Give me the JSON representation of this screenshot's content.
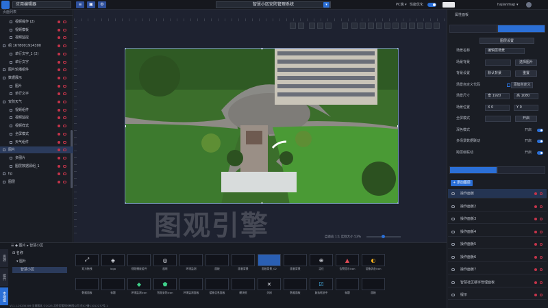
{
  "topbar": {
    "app_name": "应用编辑器",
    "title": "智慧小区安防管理系统",
    "device": "PC端 ▾",
    "preview_label": "性能优化",
    "user": "hajianmap ▾"
  },
  "left_panel": {
    "header": "页面列表",
    "items": [
      {
        "label": "视频操作 (2)",
        "indent": 14,
        "icon": "folder-icon"
      },
      {
        "label": "视频模板",
        "indent": 14,
        "icon": "video-icon"
      },
      {
        "label": "视频监控",
        "indent": 14,
        "icon": "video-icon"
      },
      {
        "label": "组 1678001914300",
        "indent": 4,
        "icon": "folder-icon"
      },
      {
        "label": "单行文字_1 (2)",
        "indent": 14,
        "icon": "text-icon"
      },
      {
        "label": "单行文字",
        "indent": 14,
        "icon": "text-icon"
      },
      {
        "label": "图片轮播组件",
        "indent": 4,
        "icon": "image-icon"
      },
      {
        "label": "数据展示",
        "indent": 4,
        "icon": "folder-icon"
      },
      {
        "label": "图片",
        "indent": 14,
        "icon": "image-icon"
      },
      {
        "label": "单行文字",
        "indent": 14,
        "icon": "text-icon"
      },
      {
        "label": "安防天气",
        "indent": 4,
        "icon": "folder-icon"
      },
      {
        "label": "视频组件",
        "indent": 14,
        "icon": "video-icon"
      },
      {
        "label": "视频监控",
        "indent": 14,
        "icon": "video-icon"
      },
      {
        "label": "视频样式",
        "indent": 14,
        "icon": "video-icon"
      },
      {
        "label": "全屏模式",
        "indent": 14,
        "icon": "fullscreen-icon"
      },
      {
        "label": "天气组件",
        "indent": 14,
        "icon": "weather-icon"
      },
      {
        "label": "图片",
        "indent": 4,
        "icon": "image-icon",
        "selected": true
      },
      {
        "label": "多图片",
        "indent": 14,
        "icon": "image-icon"
      },
      {
        "label": "图层数据源组_1",
        "indent": 14,
        "icon": "data-icon"
      },
      {
        "label": "hp",
        "indent": 4,
        "icon": "folder-icon"
      },
      {
        "label": "图层",
        "indent": 4,
        "icon": "layer-icon"
      }
    ]
  },
  "canvas": {
    "zoom_label": "自适应",
    "ratio": "1:1",
    "zoom_value": "53%",
    "actual_size": "实际大小",
    "watermark": "图观引擎"
  },
  "right_panel": {
    "header": "属性面板",
    "wide_button": "图层设置",
    "props": [
      {
        "label": "场景名称",
        "input": "编辑层场景"
      },
      {
        "label": "场景背景",
        "input": "",
        "button": "选择图片"
      },
      {
        "label": "背景设置",
        "input": "默认背景",
        "button": "重置"
      },
      {
        "label": "场景自定义代码",
        "button": "添加自定义"
      },
      {
        "label": "场景尺寸",
        "input": "宽 1920",
        "input2": "高 1080"
      },
      {
        "label": "场景位置",
        "input": "X 0",
        "input2": "Y 0"
      },
      {
        "label": "全屏模式",
        "input": "",
        "button": "开启"
      },
      {
        "label": "深色模式",
        "switch_label": "开启"
      },
      {
        "label": "多场景数据联动",
        "switch_label": "开启"
      },
      {
        "label": "跨层级联动",
        "switch_label": "开启"
      }
    ],
    "add_layer": "+ 添加图层",
    "layers": [
      {
        "label": "操作面板",
        "selected": true
      },
      {
        "label": "操作面板2"
      },
      {
        "label": "操作面板3"
      },
      {
        "label": "操作面板4"
      },
      {
        "label": "操作面板5"
      },
      {
        "label": "操作面板6"
      },
      {
        "label": "操作面板7"
      },
      {
        "label": "智慧社区楼宇管理面板"
      },
      {
        "label": "提示"
      }
    ]
  },
  "bottom_panel": {
    "breadcrumb": "☰  ◆ 图片  ▸ 智慧小区",
    "side_tabs": [
      "资源",
      "组件",
      "本地组"
    ],
    "tree": [
      {
        "label": "⊞ 名称"
      },
      {
        "label": "▾ 图片"
      },
      {
        "label": "智慧小区",
        "selected": true
      }
    ],
    "components_row1": [
      {
        "label": "双方拖拽",
        "thumb": "resize-icon"
      },
      {
        "label": "logo",
        "thumb": "logo-icon"
      },
      {
        "label": "视频播放组件",
        "thumb": "video-thumb"
      },
      {
        "label": "旋转",
        "thumb": "rotate-icon"
      },
      {
        "label": "环境监测",
        "thumb": "panel-thumb"
      },
      {
        "label": "面板",
        "thumb": "panel-thumb"
      },
      {
        "label": "面板背景",
        "thumb": "panel-thumb"
      },
      {
        "label": "面板背景_02",
        "thumb": "blue-panel-thumb"
      },
      {
        "label": "面板背景",
        "thumb": "panel-thumb"
      },
      {
        "label": "定位",
        "thumb": "target-icon"
      },
      {
        "label": "告警提示icon",
        "thumb": "alarm-icon"
      },
      {
        "label": "设备状态icon",
        "thumb": "gauge-icon"
      }
    ],
    "components_row2": [
      {
        "label": "数据面板",
        "thumb": "panel-thumb"
      },
      {
        "label": "标题",
        "thumb": "panel-thumb"
      },
      {
        "label": "环境监测icon",
        "thumb": "diamond-icon"
      },
      {
        "label": "智慧安防icon",
        "thumb": "shield-icon"
      },
      {
        "label": "环境监测面板",
        "thumb": "panel-thumb"
      },
      {
        "label": "楼栋信息面板",
        "thumb": "panel-thumb"
      },
      {
        "label": "模块框",
        "thumb": "panel-thumb"
      },
      {
        "label": "关闭",
        "thumb": "close-icon"
      },
      {
        "label": "数据面板",
        "thumb": "panel-thumb"
      },
      {
        "label": "复选框选中",
        "thumb": "check-icon"
      },
      {
        "label": "标题",
        "thumb": "panel-thumb"
      },
      {
        "label": "面板",
        "thumb": "panel-thumb"
      }
    ]
  },
  "statusbar": "V11.1.20230309 当前版本  ©2023 北京优锘科技有限公司  京ICP备11012277号-1"
}
